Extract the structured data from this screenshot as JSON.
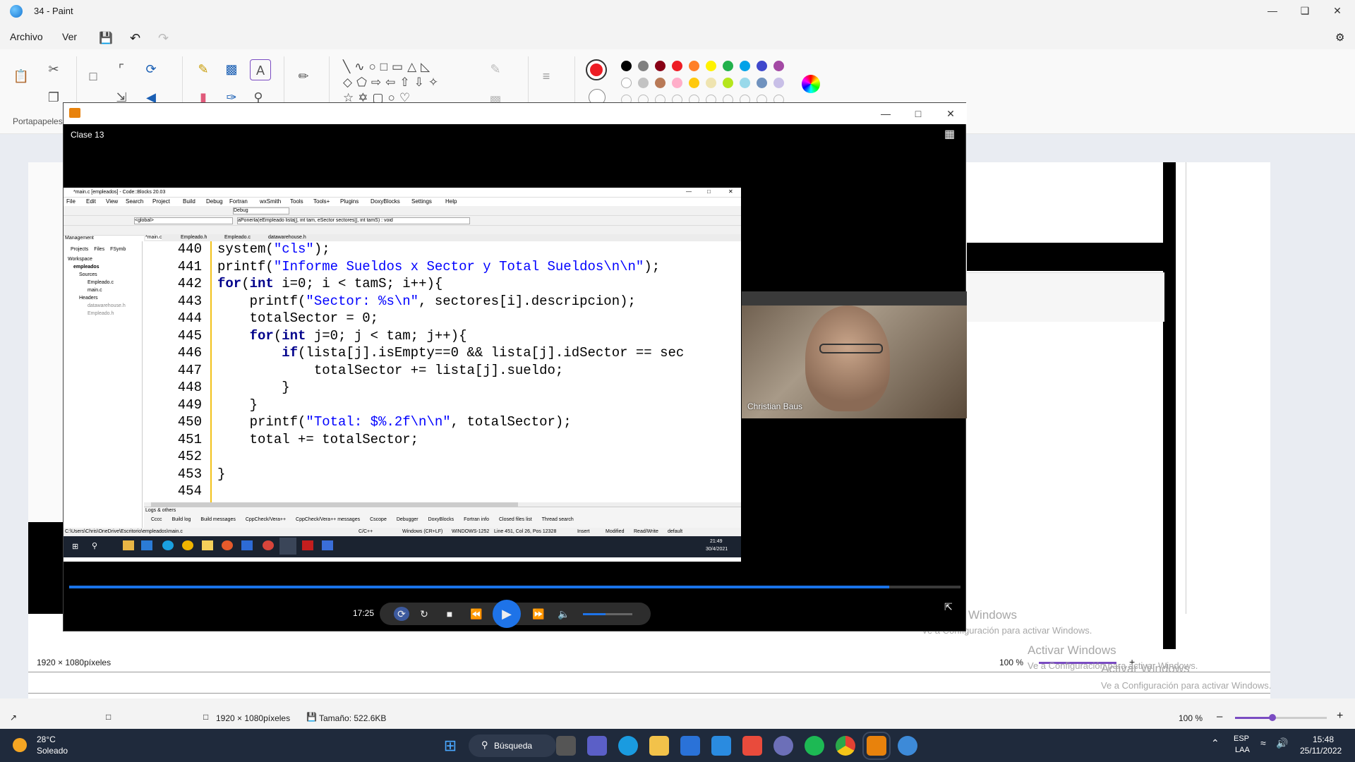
{
  "paint": {
    "title": "34 - Paint",
    "menu": {
      "file": "Archivo",
      "view": "Ver"
    },
    "ribbon_group": "Portapapeles",
    "status": {
      "dimensions": "1920 × 1080píxeles",
      "size": "Tamaño: 522.6KB",
      "zoom": "100 %"
    },
    "inner_status": {
      "dimensions": "1920 × 1080píxeles",
      "zoom": "100 %"
    },
    "colors": [
      "#000000",
      "#7f7f7f",
      "#880015",
      "#ed1c24",
      "#ff7f27",
      "#fff200",
      "#22b14c",
      "#00a2e8",
      "#3f48cc",
      "#a349a4",
      "#ffffff",
      "#c3c3c3",
      "#b97a57",
      "#ffaec9",
      "#ffc90e",
      "#efe4b0",
      "#b5e61d",
      "#99d9ea",
      "#7092be",
      "#c8bfe7"
    ],
    "primary_color": "#ed1c24"
  },
  "player": {
    "video_title": "Clase 13",
    "time": "17:25",
    "speaker_name": "Christian Baus",
    "progress": 0.92,
    "volume": 0.45
  },
  "codeblocks": {
    "title": "*main.c [empleados] - Code::Blocks 20.03",
    "menu": [
      "File",
      "Edit",
      "View",
      "Search",
      "Project",
      "Build",
      "Debug",
      "Fortran",
      "wxSmith",
      "Tools",
      "Tools+",
      "Plugins",
      "DoxyBlocks",
      "Settings",
      "Help"
    ],
    "build_target": "Debug",
    "scope": "<global>",
    "function_sig": "aPonerla(eEmpleado lista[], int tam, eSector sectores[], int tamS) : void",
    "tabs": [
      "*main.c",
      "Empleado.h",
      "Empleado.c",
      "datawarehouse.h"
    ],
    "management": {
      "title": "Management",
      "tabs": [
        "Projects",
        "Files",
        "FSymb"
      ],
      "tree": [
        "Workspace",
        "empleados",
        "Sources",
        "Empleado.c",
        "main.c",
        "Headers",
        "datawarehouse.h",
        "Empleado.h"
      ]
    },
    "code": [
      {
        "ln": "440",
        "text": "system(\"cls\");"
      },
      {
        "ln": "441",
        "text": "printf(\"Informe Sueldos x Sector y Total Sueldos\\n\\n\");"
      },
      {
        "ln": "442",
        "text": "for(int i=0; i < tamS; i++){"
      },
      {
        "ln": "443",
        "text": "    printf(\"Sector: %s\\n\", sectores[i].descripcion);"
      },
      {
        "ln": "444",
        "text": "    totalSector = 0;"
      },
      {
        "ln": "445",
        "text": "    for(int j=0; j < tam; j++){"
      },
      {
        "ln": "446",
        "text": "        if(lista[j].isEmpty==0 && lista[j].idSector == sec"
      },
      {
        "ln": "447",
        "text": "            totalSector += lista[j].sueldo;"
      },
      {
        "ln": "448",
        "text": "        }"
      },
      {
        "ln": "449",
        "text": "    }"
      },
      {
        "ln": "450",
        "text": "    printf(\"Total: $%.2f\\n\\n\", totalSector);"
      },
      {
        "ln": "451",
        "text": "    total += totalSector;"
      },
      {
        "ln": "452",
        "text": ""
      },
      {
        "ln": "453",
        "text": "}"
      },
      {
        "ln": "454",
        "text": ""
      }
    ],
    "logs_title": "Logs & others",
    "log_tabs": [
      "Cccc",
      "Build log",
      "Build messages",
      "CppCheck/Vera++",
      "CppCheck/Vera++ messages",
      "Cscope",
      "Debugger",
      "DoxyBlocks",
      "Fortran info",
      "Closed files list",
      "Thread search"
    ],
    "status": {
      "path": "C:\\Users\\Chris\\OneDrive\\Escritorio\\empleados\\main.c",
      "lang": "C/C++",
      "eol": "Windows (CR+LF)",
      "enc": "WINDOWS-1252",
      "pos": "Line 451, Col 26, Pos 12328",
      "mode": "Insert",
      "mod": "Modified",
      "rw": "Read/Write",
      "profile": "default"
    },
    "clock": {
      "time": "21:49",
      "date": "30/4/2021"
    }
  },
  "activate": {
    "title": "Activar Windows",
    "subtitle": "Ve a Configuración para activar Windows.",
    "partial": "Windows"
  },
  "taskbar": {
    "weather": {
      "temp": "28°C",
      "desc": "Soleado"
    },
    "search": "Búsqueda",
    "lang": "ESP",
    "lang2": "LAA",
    "time": "15:48",
    "date": "25/11/2022"
  }
}
